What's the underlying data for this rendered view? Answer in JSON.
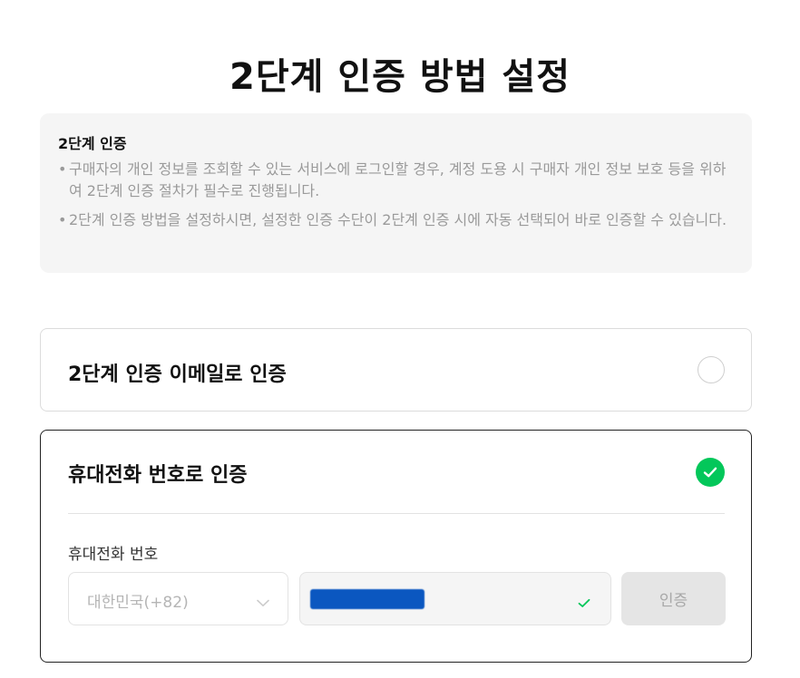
{
  "page": {
    "title": "2단계 인증 방법 설정"
  },
  "info": {
    "heading": "2단계 인증",
    "bullet_icon": "bullet-dot",
    "items": [
      "구매자의 개인 정보를 조회할 수 있는 서비스에 로그인할 경우, 계정 도용 시 구매자 개인 정보 보호 등을 위하여 2단계 인증 절차가 필수로 진행됩니다.",
      "2단계 인증 방법을 설정하시면, 설정한 인증 수단이 2단계 인증 시에 자동 선택되어 바로 인증할 수 있습니다."
    ]
  },
  "options": {
    "email": {
      "label": "2단계 인증 이메일로 인증",
      "selected": false,
      "icon": "radio-unchecked-icon"
    },
    "phone": {
      "label": "휴대전화 번호로 인증",
      "selected": true,
      "icon": "check-circle-icon",
      "field_label": "휴대전화 번호",
      "country_select": {
        "value": "대한민국(+82)",
        "icon": "chevron-down-icon"
      },
      "phone_input": {
        "value": "",
        "redacted": true,
        "valid_icon": "check-icon"
      },
      "verify_button": "인증"
    }
  },
  "colors": {
    "accent_green": "#03c75a",
    "redaction_blue": "#0b57c0",
    "info_bg": "#f5f5f5",
    "muted_text": "#9a9a9a",
    "disabled_button_bg": "#e5e5e5"
  }
}
